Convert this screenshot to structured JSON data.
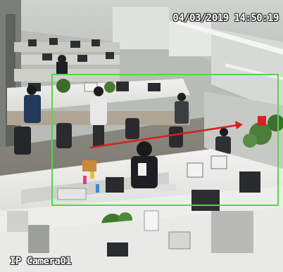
{
  "osd": {
    "timestamp": "04/03/2019 14:50:19",
    "camera_name": "IP Camera01"
  },
  "overlays": {
    "detection_box_color": "#5ad24f",
    "trajectory_arrow_color": "#d81e1e",
    "person_marker_color": "#e02020"
  },
  "icons": {
    "trajectory": "arrow-right-icon",
    "person_marker": "person-marker-icon"
  }
}
